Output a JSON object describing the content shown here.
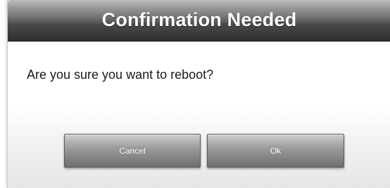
{
  "dialog": {
    "title": "Confirmation Needed",
    "message": "Are you sure you want to reboot?",
    "buttons": {
      "cancel_label": "Cancel",
      "ok_label": "Ok"
    }
  },
  "colors": {
    "title_text": "#ffffff",
    "titlebar_dark": "#2e2e2e",
    "button_gradient_top": "#cfcfcf",
    "button_gradient_bottom": "#6f6f6f"
  }
}
